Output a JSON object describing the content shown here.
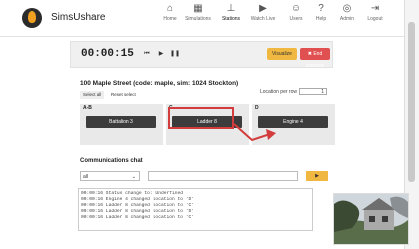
{
  "app": {
    "name": "SimsUshare"
  },
  "nav": [
    {
      "label": "Home",
      "icon": "home-icon"
    },
    {
      "label": "Simulations",
      "icon": "map-icon"
    },
    {
      "label": "Stations",
      "icon": "sitemap-icon"
    },
    {
      "label": "Watch Live",
      "icon": "play-icon"
    },
    {
      "label": "Users",
      "icon": "users-icon"
    },
    {
      "label": "Help",
      "icon": "help-icon"
    },
    {
      "label": "Admin",
      "icon": "user-icon"
    },
    {
      "label": "Logout",
      "icon": "logout-icon"
    }
  ],
  "timer": {
    "time": "00:00:15",
    "rewind": "⏮",
    "play": "▶",
    "pause": "❚❚",
    "btn_visualize": "Visualize",
    "btn_end": "✖ End exercise"
  },
  "incident": {
    "title": "100 Maple Street (code: maple, sim: 1024 Stockton)",
    "select_all": "Select all",
    "reset_select": "Reset select",
    "location_label": "Location per row",
    "location_value": "1",
    "columns": [
      {
        "label": "A-B",
        "unit": "Battalion 3"
      },
      {
        "label": "C",
        "unit": "Ladder 8"
      },
      {
        "label": "D",
        "unit": "Engine 4"
      }
    ]
  },
  "comms": {
    "title": "Communications chat",
    "channel": "all",
    "send_label": "▶",
    "log": [
      "00:00:16 Status change to: Underfined",
      "00:00:16 Engine 4 changed location to 'D'",
      "00:00:16 Ladder 8 changed location to 'C'",
      "00:00:16 Ladder 8 changed location to 'D'",
      "00:00:16 Ladder 8 changed location to 'C'"
    ]
  },
  "colors": {
    "accent": "#f0b840",
    "danger": "#e05050",
    "highlight": "#d23c3c",
    "unit_bg": "#3c3c3c"
  }
}
